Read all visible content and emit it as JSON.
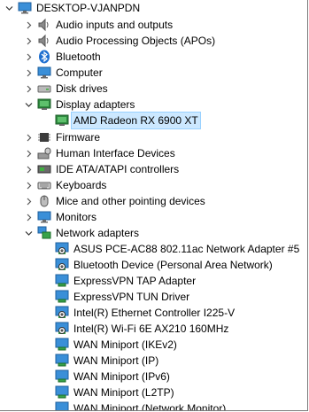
{
  "root": {
    "label": "DESKTOP-VJANPDN",
    "icon": "computer-icon"
  },
  "categories": [
    {
      "label": "Audio inputs and outputs",
      "icon": "speaker-icon",
      "expanded": false
    },
    {
      "label": "Audio Processing Objects (APOs)",
      "icon": "speaker-icon",
      "expanded": false
    },
    {
      "label": "Bluetooth",
      "icon": "bluetooth-icon",
      "expanded": false
    },
    {
      "label": "Computer",
      "icon": "computer-icon",
      "expanded": false
    },
    {
      "label": "Disk drives",
      "icon": "disk-drive-icon",
      "expanded": false
    },
    {
      "label": "Display adapters",
      "icon": "display-adapter-icon",
      "expanded": true
    },
    {
      "label": "AMD Radeon RX 6900 XT",
      "icon": "display-adapter-icon",
      "selected": true
    },
    {
      "label": "Firmware",
      "icon": "chip-icon",
      "expanded": false
    },
    {
      "label": "Human Interface Devices",
      "icon": "hid-icon",
      "expanded": false
    },
    {
      "label": "IDE ATA/ATAPI controllers",
      "icon": "controller-icon",
      "expanded": false
    },
    {
      "label": "Keyboards",
      "icon": "keyboard-icon",
      "expanded": false
    },
    {
      "label": "Mice and other pointing devices",
      "icon": "mouse-icon",
      "expanded": false
    },
    {
      "label": "Monitors",
      "icon": "monitor-icon",
      "expanded": false
    },
    {
      "label": "Network adapters",
      "icon": "network-icon",
      "expanded": true
    },
    {
      "label": "ASUS PCE-AC88 802.11ac Network Adapter #5",
      "icon": "network-adapter-disabled-icon"
    },
    {
      "label": "Bluetooth Device (Personal Area Network)",
      "icon": "network-adapter-disabled-icon"
    },
    {
      "label": "ExpressVPN TAP Adapter",
      "icon": "network-adapter-icon"
    },
    {
      "label": "ExpressVPN TUN Driver",
      "icon": "network-adapter-icon"
    },
    {
      "label": "Intel(R) Ethernet Controller I225-V",
      "icon": "network-adapter-disabled-icon"
    },
    {
      "label": "Intel(R) Wi-Fi 6E AX210 160MHz",
      "icon": "network-adapter-disabled-icon"
    },
    {
      "label": "WAN Miniport (IKEv2)",
      "icon": "network-adapter-icon"
    },
    {
      "label": "WAN Miniport (IP)",
      "icon": "network-adapter-icon"
    },
    {
      "label": "WAN Miniport (IPv6)",
      "icon": "network-adapter-icon"
    },
    {
      "label": "WAN Miniport (L2TP)",
      "icon": "network-adapter-icon"
    },
    {
      "label": "WAN Miniport (Network Monitor)",
      "icon": "network-adapter-icon"
    }
  ],
  "colors": {
    "selection_bg": "#cce8ff",
    "selection_border": "#99d1ff",
    "icon_blue": "#2b7cd3",
    "icon_green": "#37a34a"
  }
}
